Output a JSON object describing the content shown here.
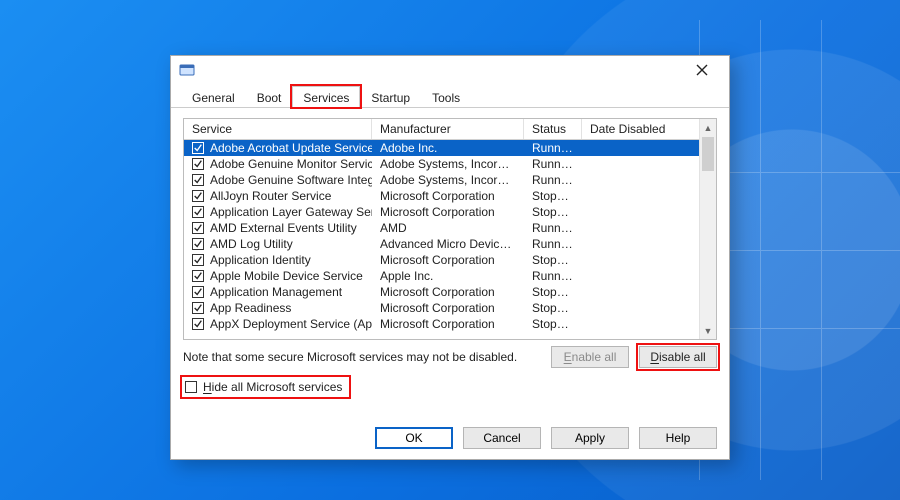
{
  "tabs": {
    "general": "General",
    "boot": "Boot",
    "services": "Services",
    "startup": "Startup",
    "tools": "Tools"
  },
  "columns": {
    "service": "Service",
    "manufacturer": "Manufacturer",
    "status": "Status",
    "date_disabled": "Date Disabled"
  },
  "rows": [
    {
      "service": "Adobe Acrobat Update Service",
      "manufacturer": "Adobe Inc.",
      "status": "Running"
    },
    {
      "service": "Adobe Genuine Monitor Service",
      "manufacturer": "Adobe Systems, Incorpora...",
      "status": "Running"
    },
    {
      "service": "Adobe Genuine Software Integri...",
      "manufacturer": "Adobe Systems, Incorpora...",
      "status": "Running"
    },
    {
      "service": "AllJoyn Router Service",
      "manufacturer": "Microsoft Corporation",
      "status": "Stopped"
    },
    {
      "service": "Application Layer Gateway Service",
      "manufacturer": "Microsoft Corporation",
      "status": "Stopped"
    },
    {
      "service": "AMD External Events Utility",
      "manufacturer": "AMD",
      "status": "Running"
    },
    {
      "service": "AMD Log Utility",
      "manufacturer": "Advanced Micro Devices, I...",
      "status": "Running"
    },
    {
      "service": "Application Identity",
      "manufacturer": "Microsoft Corporation",
      "status": "Stopped"
    },
    {
      "service": "Apple Mobile Device Service",
      "manufacturer": "Apple Inc.",
      "status": "Running"
    },
    {
      "service": "Application Management",
      "manufacturer": "Microsoft Corporation",
      "status": "Stopped"
    },
    {
      "service": "App Readiness",
      "manufacturer": "Microsoft Corporation",
      "status": "Stopped"
    },
    {
      "service": "AppX Deployment Service (AppX...",
      "manufacturer": "Microsoft Corporation",
      "status": "Stopped"
    }
  ],
  "note": "Note that some secure Microsoft services may not be disabled.",
  "buttons": {
    "enable_all": "Enable all",
    "disable_all": "Disable all"
  },
  "hide_label_pre": "H",
  "hide_label_post": "ide all Microsoft services",
  "footer": {
    "ok": "OK",
    "cancel": "Cancel",
    "apply": "Apply",
    "help": "Help"
  }
}
